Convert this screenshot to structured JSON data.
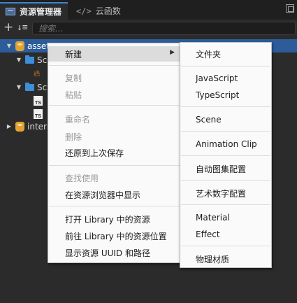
{
  "tabs": [
    {
      "label": "资源管理器",
      "icon": "asset-panel-icon",
      "active": true
    },
    {
      "label": "云函数",
      "icon": "code-icon",
      "active": false
    }
  ],
  "toolbar": {
    "add_label": "+",
    "sort_label": "↓≡",
    "search_placeholder": "搜索..."
  },
  "tree": [
    {
      "label": "asset",
      "icon": "database-icon",
      "expanded": true,
      "selected": true
    },
    {
      "label": "Sc",
      "icon": "folder-icon",
      "expanded": true
    },
    {
      "label": "",
      "icon": "fire-icon"
    },
    {
      "label": "Sc",
      "icon": "folder-icon",
      "expanded": true
    },
    {
      "label": "",
      "icon": "typescript-icon"
    },
    {
      "label": "",
      "icon": "typescript-icon"
    },
    {
      "label": "intern",
      "icon": "database-icon",
      "expanded": false
    }
  ],
  "ts_badge": "TS",
  "context_menu": {
    "items": [
      {
        "label": "新建",
        "enabled": true,
        "has_submenu": true,
        "hover": true
      },
      {
        "label": "复制",
        "enabled": false
      },
      {
        "label": "粘贴",
        "enabled": false
      },
      {
        "label": "重命名",
        "enabled": false
      },
      {
        "label": "删除",
        "enabled": false
      },
      {
        "label": "还原到上次保存",
        "enabled": true
      },
      {
        "label": "查找使用",
        "enabled": false
      },
      {
        "label": "在资源浏览器中显示",
        "enabled": true
      },
      {
        "label": "打开 Library 中的资源",
        "enabled": true
      },
      {
        "label": "前往 Library 中的资源位置",
        "enabled": true
      },
      {
        "label": "显示资源 UUID 和路径",
        "enabled": true
      }
    ]
  },
  "submenu": {
    "items": [
      {
        "label": "文件夹"
      },
      {
        "label": "JavaScript"
      },
      {
        "label": "TypeScript"
      },
      {
        "label": "Scene"
      },
      {
        "label": "Animation Clip"
      },
      {
        "label": "自动图集配置"
      },
      {
        "label": "艺术数字配置"
      },
      {
        "label": "Material"
      },
      {
        "label": "Effect"
      },
      {
        "label": "物理材质"
      }
    ]
  },
  "colors": {
    "selection": "#2c5d9a",
    "menu_bg": "#fafafa",
    "tab_accent": "#3a86d6"
  }
}
